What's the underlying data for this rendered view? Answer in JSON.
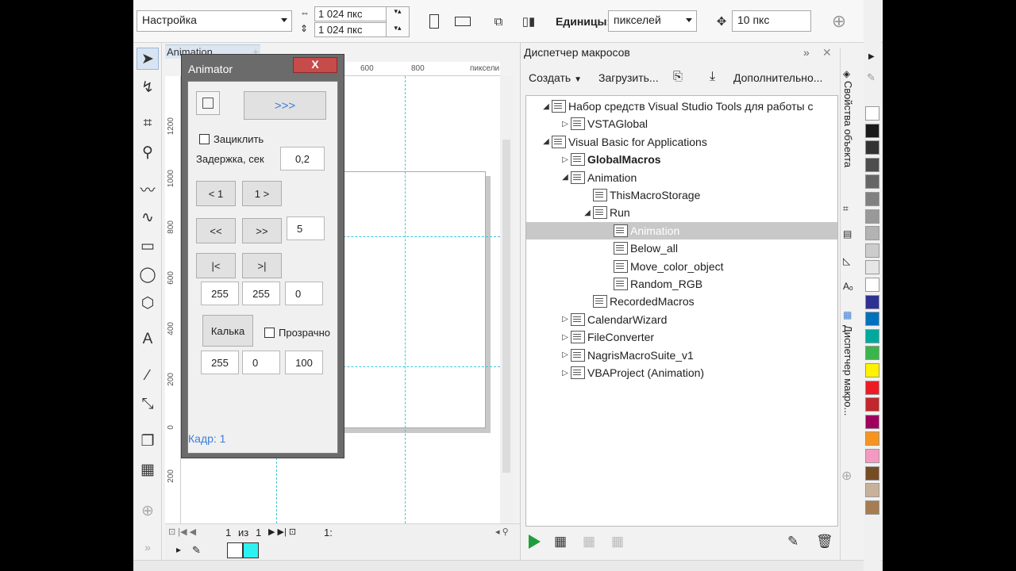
{
  "propbar": {
    "preset": "Настройка",
    "width": "1 024 пкс",
    "height": "1 024 пкс",
    "units_label": "Единицы:",
    "units_value": "пикселей",
    "nudge": "10 пкс"
  },
  "document": {
    "tab": "Animation",
    "ruler_h": [
      "600",
      "800",
      "пиксели"
    ],
    "ruler_v": [
      "1200",
      "1000",
      "800",
      "600",
      "400",
      "200",
      "0",
      "200"
    ],
    "page_nav": {
      "current": "1",
      "of": "из",
      "total": "1",
      "tab": "1:"
    }
  },
  "animator": {
    "title": "Animator",
    "close": "X",
    "play": ">>>",
    "loop_label": "Зациклить",
    "delay_label": "Задержка, сек",
    "delay_value": "0,2",
    "prev1": "< 1",
    "next1": "1 >",
    "prevN": "<<",
    "nextN": ">>",
    "step_value": "5",
    "first": "|<",
    "last": ">|",
    "rgb1": [
      "255",
      "255",
      "0"
    ],
    "tracing_button": "Калька",
    "transparent_label": "Прозрачно",
    "rgb2": [
      "255",
      "0",
      "100"
    ],
    "frame_label": "Кадр: 1"
  },
  "macro_manager": {
    "title": "Диспетчер макросов",
    "toolbar": {
      "create": "Создать",
      "load": "Загрузить...",
      "more": "Дополнительно..."
    },
    "tree": [
      {
        "label": "Набор средств Visual Studio Tools для работы с",
        "level": 0,
        "expander": "open"
      },
      {
        "label": "VSTAGlobal",
        "level": 1,
        "expander": "closed"
      },
      {
        "label": "Visual Basic for Applications",
        "level": 0,
        "expander": "open"
      },
      {
        "label": "GlobalMacros",
        "level": 1,
        "expander": "closed",
        "bold": true
      },
      {
        "label": "Animation",
        "level": 1,
        "expander": "open"
      },
      {
        "label": "ThisMacroStorage",
        "level": 2,
        "expander": "none"
      },
      {
        "label": "Run",
        "level": 2,
        "expander": "open"
      },
      {
        "label": "Animation",
        "level": 3,
        "expander": "none",
        "selected": true
      },
      {
        "label": "Below_all",
        "level": 3,
        "expander": "none"
      },
      {
        "label": "Move_color_object",
        "level": 3,
        "expander": "none"
      },
      {
        "label": "Random_RGB",
        "level": 3,
        "expander": "none"
      },
      {
        "label": "RecordedMacros",
        "level": 2,
        "expander": "none"
      },
      {
        "label": "CalendarWizard",
        "level": 1,
        "expander": "closed"
      },
      {
        "label": "FileConverter",
        "level": 1,
        "expander": "closed"
      },
      {
        "label": "NagrisMacroSuite_v1",
        "level": 1,
        "expander": "closed"
      },
      {
        "label": "VBAProject (Animation)",
        "level": 1,
        "expander": "closed"
      }
    ]
  },
  "side_tabs": {
    "object_props": "Свойства объекта",
    "macro_manager": "Диспетчер макро..."
  },
  "palette_colors": [
    "#ffffff",
    "#1a1a1a",
    "#333333",
    "#4d4d4d",
    "#666666",
    "#808080",
    "#999999",
    "#b3b3b3",
    "#cccccc",
    "#e6e6e6",
    "#ffffff",
    "#2e3192",
    "#0072bc",
    "#00a99d",
    "#39b54a",
    "#fff200",
    "#ed1c24",
    "#c1272d",
    "#9e005d",
    "#f7941d",
    "#f49ac1",
    "#754c24",
    "#c7b299",
    "#a67c52"
  ],
  "colors": {
    "selection_bg": "#c8c8c8",
    "close_red": "#c64b4b",
    "play_green": "#1e9e3a",
    "guide_cyan": "#3cc8dc",
    "link_blue": "#3c7ed8"
  }
}
